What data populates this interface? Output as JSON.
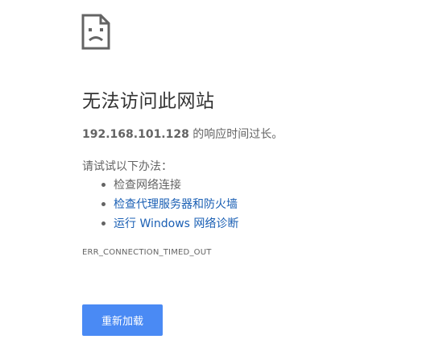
{
  "title": "无法访问此网站",
  "summary": {
    "host": "192.168.101.128",
    "message": " 的响应时间过长。"
  },
  "suggestions": {
    "heading": "请试试以下办法：",
    "items": [
      {
        "label": "检查网络连接",
        "link": false
      },
      {
        "label": "检查代理服务器和防火墙",
        "link": true
      },
      {
        "label": "运行 Windows 网络诊断",
        "link": true
      }
    ]
  },
  "error_code": "ERR_CONNECTION_TIMED_OUT",
  "reload_button": {
    "label": "重新加载"
  },
  "icons": {
    "error": "sad-page-icon"
  },
  "colors": {
    "title": "#333333",
    "text": "#646464",
    "link": "#1a5fb4",
    "button_bg": "#4a8af4",
    "button_text": "#ffffff"
  }
}
